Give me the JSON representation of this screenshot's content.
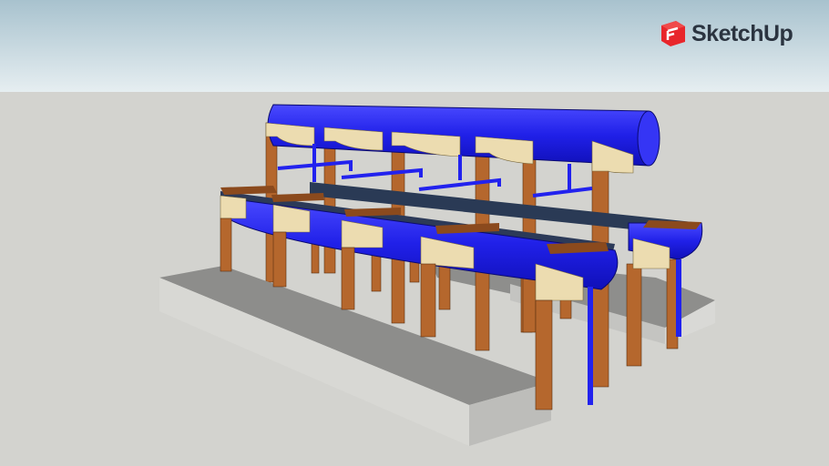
{
  "brand": {
    "name": "SketchUp",
    "logo_icon": "sketchup-logo-icon",
    "logo_color": "#e8262b"
  },
  "scene": {
    "sky_top": "#a8c2ce",
    "sky_bottom": "#e6eef1",
    "ground": "#d3d3cf",
    "pipe_color": "#2222ee",
    "wood_color": "#b5672d",
    "bracket_color": "#ecdcb0",
    "concrete_color": "#c9c9c6"
  }
}
